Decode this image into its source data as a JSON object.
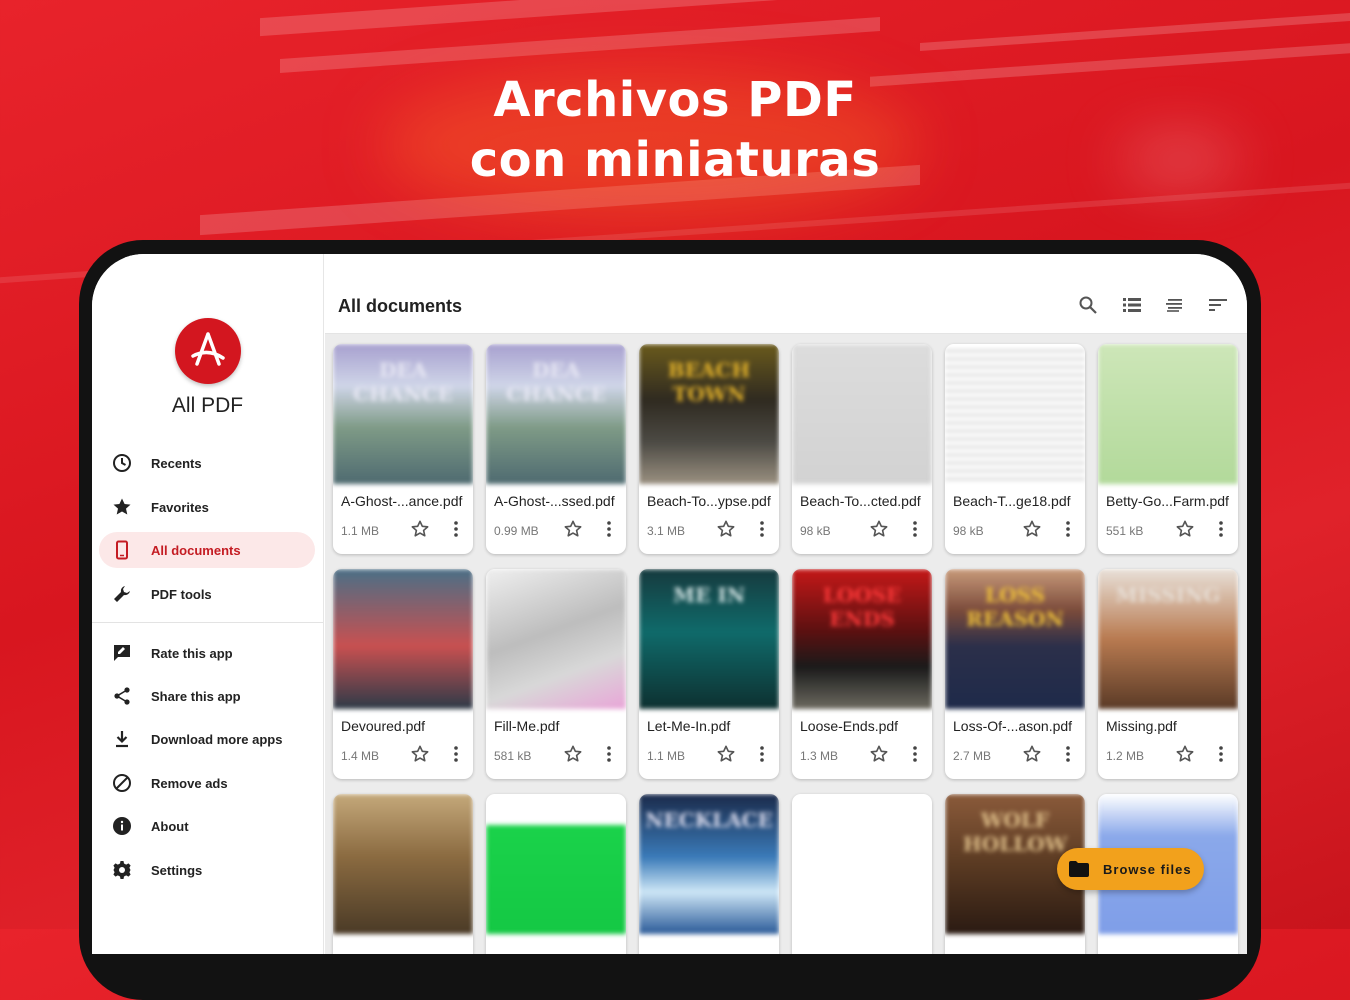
{
  "headline": {
    "line1": "Archivos PDF",
    "line2": "con miniaturas"
  },
  "app": {
    "name": "All PDF",
    "brand_color": "#d3161f",
    "accent_fab": "#f2a11c"
  },
  "nav": {
    "items": [
      {
        "label": "Recents",
        "icon": "clock-icon"
      },
      {
        "label": "Favorites",
        "icon": "star-icon"
      },
      {
        "label": "All documents",
        "icon": "phone-icon",
        "active": true
      },
      {
        "label": "PDF tools",
        "icon": "wrench-icon"
      }
    ],
    "secondary": [
      {
        "label": "Rate this app",
        "icon": "rate-icon"
      },
      {
        "label": "Share this app",
        "icon": "share-icon"
      },
      {
        "label": "Download more apps",
        "icon": "download-icon"
      },
      {
        "label": "Remove ads",
        "icon": "block-icon"
      },
      {
        "label": "About",
        "icon": "info-icon"
      },
      {
        "label": "Settings",
        "icon": "gear-icon"
      }
    ]
  },
  "toolbar": {
    "title": "All documents",
    "icons": [
      "search-icon",
      "list-view-icon",
      "sort-icon",
      "filter-icon"
    ]
  },
  "files": [
    {
      "name": "A-Ghost-...ance.pdf",
      "size": "1.1 MB",
      "cover": "DEA CHANCE"
    },
    {
      "name": "A-Ghost-...ssed.pdf",
      "size": "0.99 MB",
      "cover": "DEA CHANCE"
    },
    {
      "name": "Beach-To...ypse.pdf",
      "size": "3.1 MB",
      "cover": "BEACH TOWN"
    },
    {
      "name": "Beach-To...cted.pdf",
      "size": "98 kB",
      "cover": ""
    },
    {
      "name": "Beach-T...ge18.pdf",
      "size": "98 kB",
      "cover": ""
    },
    {
      "name": "Betty-Go...Farm.pdf",
      "size": "551 kB",
      "cover": ""
    },
    {
      "name": "Devoured.pdf",
      "size": "1.4 MB",
      "cover": ""
    },
    {
      "name": "Fill-Me.pdf",
      "size": "581 kB",
      "cover": ""
    },
    {
      "name": "Let-Me-In.pdf",
      "size": "1.1 MB",
      "cover": "ME IN"
    },
    {
      "name": "Loose-Ends.pdf",
      "size": "1.3 MB",
      "cover": "LOOSE ENDS"
    },
    {
      "name": "Loss-Of-...ason.pdf",
      "size": "2.7 MB",
      "cover": "LOSS REASON"
    },
    {
      "name": "Missing.pdf",
      "size": "1.2 MB",
      "cover": "MISSING"
    },
    {
      "name": "",
      "size": "",
      "cover": ""
    },
    {
      "name": "",
      "size": "",
      "cover": ""
    },
    {
      "name": "",
      "size": "",
      "cover": "NECKLACE"
    },
    {
      "name": "",
      "size": "",
      "cover": ""
    },
    {
      "name": "",
      "size": "",
      "cover": "WOLF HOLLOW"
    },
    {
      "name": "",
      "size": "",
      "cover": ""
    }
  ],
  "fab": {
    "label": "Browse files",
    "icon": "folder-icon"
  }
}
